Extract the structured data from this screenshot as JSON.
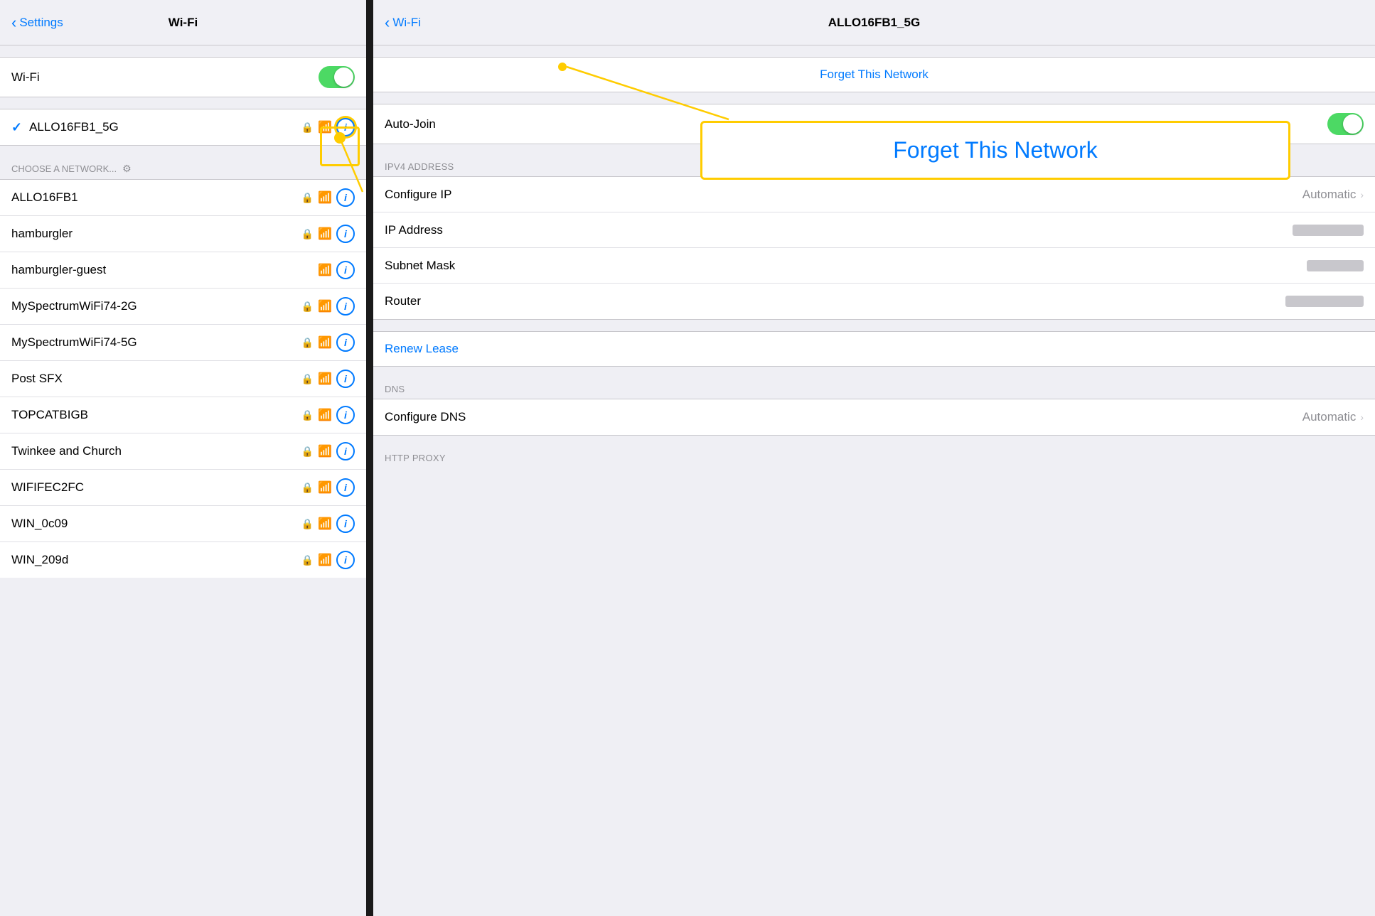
{
  "left": {
    "nav": {
      "back_label": "Settings",
      "title": "Wi-Fi"
    },
    "wifi_row": {
      "label": "Wi-Fi",
      "toggle_on": true
    },
    "connected_network": {
      "name": "ALLO16FB1_5G"
    },
    "choose_header": "CHOOSE A NETWORK...",
    "networks": [
      {
        "name": "ALLO16FB1",
        "locked": true,
        "has_wifi": true
      },
      {
        "name": "hamburgler",
        "locked": true,
        "has_wifi": true
      },
      {
        "name": "hamburgler-guest",
        "locked": false,
        "has_wifi": true
      },
      {
        "name": "MySpectrumWiFi74-2G",
        "locked": true,
        "has_wifi": true
      },
      {
        "name": "MySpectrumWiFi74-5G",
        "locked": true,
        "has_wifi": true
      },
      {
        "name": "Post SFX",
        "locked": true,
        "has_wifi": true
      },
      {
        "name": "TOPCATBIGB",
        "locked": true,
        "has_wifi": true
      },
      {
        "name": "Twinkee and Church",
        "locked": true,
        "has_wifi": true
      },
      {
        "name": "WIFIFEC2FC",
        "locked": true,
        "has_wifi": true
      },
      {
        "name": "WIN_0c09",
        "locked": true,
        "has_wifi": true
      },
      {
        "name": "WIN_209d",
        "locked": true,
        "has_wifi": true
      }
    ]
  },
  "right": {
    "nav": {
      "back_label": "Wi-Fi",
      "title": "ALLO16FB1_5G"
    },
    "forget_label": "Forget This Network",
    "auto_join_label": "Auto-Join",
    "ipv4_header": "IPV4 ADDRESS",
    "rows": [
      {
        "label": "Configure IP",
        "value": "Automatic",
        "has_chevron": true,
        "blurred": false
      },
      {
        "label": "IP Address",
        "value": "",
        "blurred": true
      },
      {
        "label": "Subnet Mask",
        "value": "",
        "blurred": true
      },
      {
        "label": "Router",
        "value": "",
        "blurred": true,
        "blurred_type": "router"
      }
    ],
    "renew_lease": "Renew Lease",
    "dns_header": "DNS",
    "dns_rows": [
      {
        "label": "Configure DNS",
        "value": "Automatic",
        "has_chevron": true
      }
    ],
    "http_proxy_header": "HTTP PROXY"
  },
  "annotation": {
    "forget_label": "Forget This Network",
    "info_icon": "ℹ"
  }
}
